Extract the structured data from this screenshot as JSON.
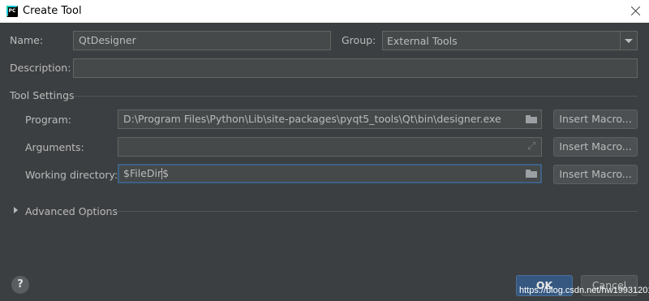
{
  "window": {
    "title": "Create Tool",
    "app_icon_text": "PC"
  },
  "form": {
    "name_label": "Name:",
    "name_value": "QtDesigner",
    "group_label": "Group:",
    "group_value": "External Tools",
    "description_label": "Description:",
    "description_value": ""
  },
  "tool_settings": {
    "section_label": "Tool Settings",
    "program_label": "Program:",
    "program_value": "D:\\Program Files\\Python\\Lib\\site-packages\\pyqt5_tools\\Qt\\bin\\designer.exe",
    "arguments_label": "Arguments:",
    "arguments_value": "",
    "working_dir_label": "Working directory:",
    "working_dir_value_a": "$FileDir",
    "working_dir_value_b": "$",
    "insert_macro_label": "Insert Macro..."
  },
  "advanced": {
    "label": "Advanced Options"
  },
  "footer": {
    "help_label": "?",
    "ok_label": "OK",
    "cancel_label": "Cancel",
    "watermark": "https://blog.csdn.net/hw19931201"
  }
}
